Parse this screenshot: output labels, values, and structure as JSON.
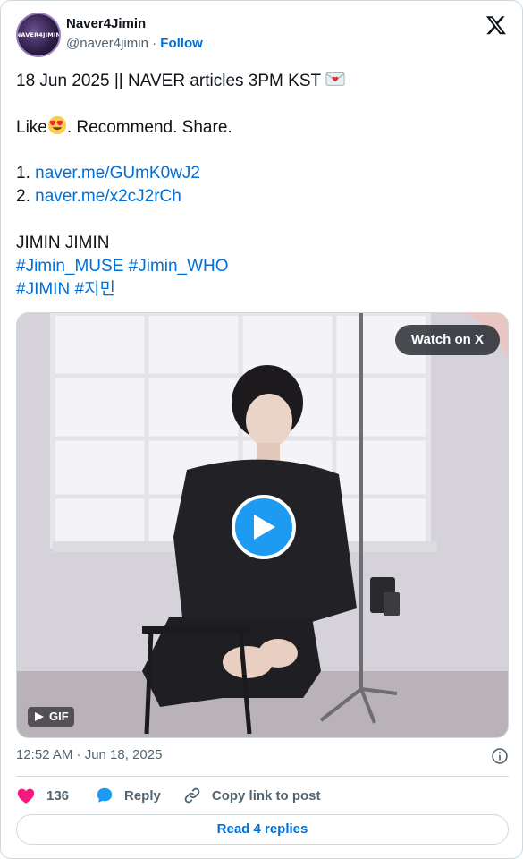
{
  "author": {
    "name": "Naver4Jimin",
    "handle": "@naver4jimin",
    "separator": "·",
    "follow_label": "Follow",
    "avatar_text": "NAVER4JIMIN"
  },
  "tweet": {
    "line1": "18 Jun 2025 || NAVER articles 3PM KST",
    "line1_emoji": "love-letter-icon",
    "line2_prefix": "Like",
    "line2_emoji": "heart-eyes-emoji",
    "line2_suffix": ". Recommend. Share.",
    "links": [
      {
        "num": "1.",
        "url": "naver.me/GUmK0wJ2"
      },
      {
        "num": "2.",
        "url": "naver.me/x2cJ2rCh"
      }
    ],
    "line_names": "JIMIN JIMIN",
    "hashtags_row1": [
      "#Jimin_MUSE",
      "#Jimin_WHO"
    ],
    "hashtags_row2": [
      "#JIMIN",
      "#지민"
    ]
  },
  "media": {
    "watch_label": "Watch on X",
    "gif_label": "GIF",
    "play_icon": "play-icon"
  },
  "timestamp": "12:52 AM · Jun 18, 2025",
  "actions": {
    "like_count": "136",
    "reply_label": "Reply",
    "copy_label": "Copy link to post"
  },
  "read_replies_label": "Read 4 replies",
  "colors": {
    "link": "#006fd6",
    "like": "#f91880",
    "reply": "#1d9bf0",
    "muted": "#536471"
  }
}
